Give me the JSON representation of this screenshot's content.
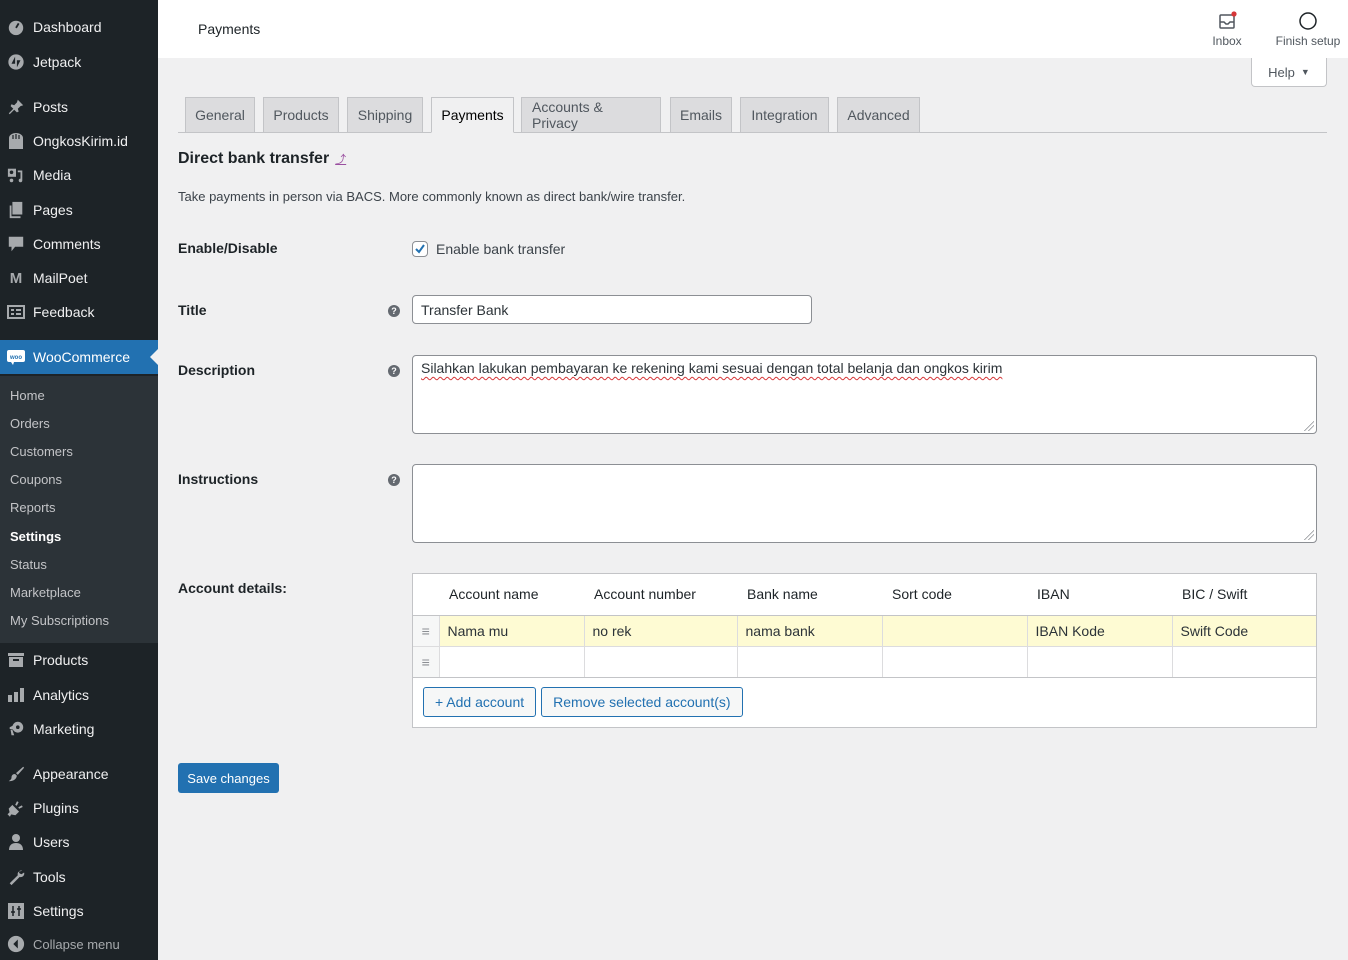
{
  "sidebar": {
    "items": [
      {
        "label": "Dashboard",
        "icon": "dashboard-icon"
      },
      {
        "label": "Jetpack",
        "icon": "jetpack-icon"
      },
      {
        "label": "Posts",
        "icon": "pin-icon"
      },
      {
        "label": "OngkosKirim.id",
        "icon": "store-icon"
      },
      {
        "label": "Media",
        "icon": "media-icon"
      },
      {
        "label": "Pages",
        "icon": "pages-icon"
      },
      {
        "label": "Comments",
        "icon": "comment-icon"
      },
      {
        "label": "MailPoet",
        "icon": "mailpoet-icon"
      },
      {
        "label": "Feedback",
        "icon": "feedback-icon"
      },
      {
        "label": "WooCommerce",
        "icon": "woo-icon"
      },
      {
        "label": "Products",
        "icon": "archive-icon"
      },
      {
        "label": "Analytics",
        "icon": "bar-chart-icon"
      },
      {
        "label": "Marketing",
        "icon": "megaphone-icon"
      },
      {
        "label": "Appearance",
        "icon": "paintbrush-icon"
      },
      {
        "label": "Plugins",
        "icon": "plugin-icon"
      },
      {
        "label": "Users",
        "icon": "user-icon"
      },
      {
        "label": "Tools",
        "icon": "wrench-icon"
      },
      {
        "label": "Settings",
        "icon": "settings-icon"
      }
    ],
    "woo_submenu": [
      "Home",
      "Orders",
      "Customers",
      "Coupons",
      "Reports",
      "Settings",
      "Status",
      "Marketplace",
      "My Subscriptions"
    ],
    "collapse_label": "Collapse menu"
  },
  "header": {
    "title": "Payments",
    "inbox_label": "Inbox",
    "finish_setup_label": "Finish setup",
    "help_label": "Help"
  },
  "tabs": [
    "General",
    "Products",
    "Shipping",
    "Payments",
    "Accounts & Privacy",
    "Emails",
    "Integration",
    "Advanced"
  ],
  "active_tab": "Payments",
  "section": {
    "title": "Direct bank transfer",
    "back_link": "⤴",
    "description": "Take payments in person via BACS. More commonly known as direct bank/wire transfer."
  },
  "form": {
    "enable": {
      "label": "Enable/Disable",
      "checkbox_label": "Enable bank transfer",
      "checked": true
    },
    "title": {
      "label": "Title",
      "value": "Transfer Bank"
    },
    "description": {
      "label": "Description",
      "value": "Silahkan lakukan pembayaran ke rekening kami sesuai dengan total belanja dan ongkos kirim"
    },
    "instructions": {
      "label": "Instructions",
      "value": ""
    },
    "account_details": {
      "label": "Account details:",
      "columns": [
        "Account name",
        "Account number",
        "Bank name",
        "Sort code",
        "IBAN",
        "BIC / Swift"
      ],
      "rows": [
        [
          "Nama mu",
          "no rek",
          "nama bank",
          "",
          "IBAN Kode",
          "Swift Code"
        ],
        [
          "",
          "",
          "",
          "",
          "",
          ""
        ]
      ],
      "add_button": "+ Add account",
      "remove_button": "Remove selected account(s)"
    }
  },
  "save_button": "Save changes",
  "colors": {
    "accent": "#2271b1",
    "sidebar": "#1d2327",
    "selected_row": "#fefbd3"
  }
}
